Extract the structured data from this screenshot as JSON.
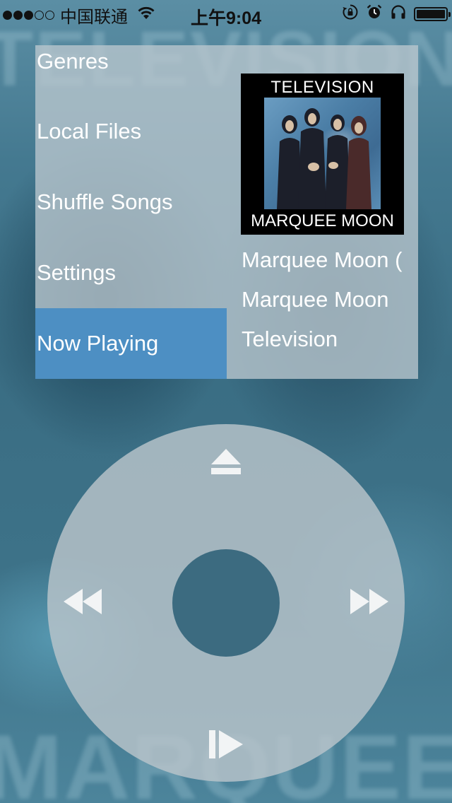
{
  "background": {
    "top_text": "TELEVISION",
    "bottom_text": "MARQUEE MOON"
  },
  "status_bar": {
    "carrier": "中国联通",
    "time": "上午9:04",
    "signal_strength_bars": 3,
    "signal_total_bars": 5,
    "battery_level": 1.0,
    "icons": [
      "wifi-icon",
      "rotation-lock-icon",
      "alarm-icon",
      "headphones-icon",
      "battery-icon"
    ]
  },
  "menu": {
    "items": [
      {
        "label": "Genres",
        "selected": false
      },
      {
        "label": "Local Files",
        "selected": false
      },
      {
        "label": "Shuffle Songs",
        "selected": false
      },
      {
        "label": "Settings",
        "selected": false
      },
      {
        "label": "Now Playing",
        "selected": true
      }
    ]
  },
  "now_playing": {
    "album_art": {
      "top_text": "TELEVISION",
      "bottom_text": "MARQUEE MOON"
    },
    "song": "Marquee Moon (",
    "album": "Marquee Moon",
    "artist": "Television"
  },
  "click_wheel": {
    "buttons": [
      "eject-icon",
      "rewind-icon",
      "fast-forward-icon",
      "play-pause-icon"
    ]
  },
  "colors": {
    "selected_item": "#4d8fc3",
    "panel": "#b8c5cd",
    "wheel": "#bac4cb",
    "wheel_center": "#3c6b80"
  }
}
